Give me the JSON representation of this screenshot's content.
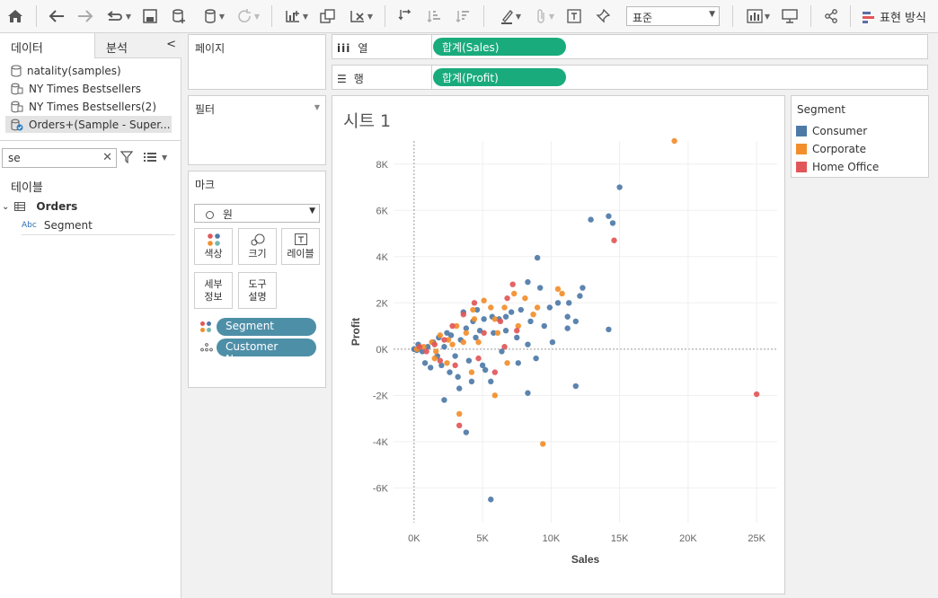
{
  "toolbar": {
    "icons": [
      "home-icon",
      "back-icon",
      "forward-icon",
      "redo-icon",
      "save-icon",
      "new-datasource-icon",
      "datasource-icon",
      "refresh-icon",
      "new-worksheet-icon",
      "duplicate-icon",
      "clear-icon",
      "swap-icon",
      "sort-asc-icon",
      "sort-desc-icon",
      "highlight-icon",
      "pin-icon",
      "label-icon",
      "fix-axes-icon",
      "show-cards-icon",
      "presentation-icon",
      "share-icon"
    ],
    "zoom_value": "표준",
    "showme_label": "표현 방식"
  },
  "data_pane": {
    "tab_data": "데이터",
    "tab_analysis": "분석",
    "collapse_glyph": "<",
    "datasources": [
      {
        "label": "natality(samples)",
        "icon": "database-icon",
        "selected": false
      },
      {
        "label": "NY Times Bestsellers",
        "icon": "multi-db-icon",
        "selected": false
      },
      {
        "label": "NY Times Bestsellers(2)",
        "icon": "multi-db-icon",
        "selected": false
      },
      {
        "label": "Orders+(Sample - Super...",
        "icon": "db-check-icon",
        "selected": true
      }
    ],
    "search_value": "se",
    "tables_label": "테이블",
    "table_name": "Orders",
    "field_type": "Abc",
    "field_name": "Segment"
  },
  "shelves": {
    "pages_label": "페이지",
    "filters_label": "필터",
    "columns_label": "열",
    "rows_label": "행",
    "columns_pill": "합계(Sales)",
    "rows_pill": "합계(Profit)"
  },
  "marks": {
    "title": "마크",
    "mark_type": "원",
    "buttons": [
      {
        "label": "색상",
        "icon": "color-icon"
      },
      {
        "label": "크기",
        "icon": "size-icon"
      },
      {
        "label": "레이블",
        "icon": "label-icon"
      },
      {
        "label": "세부\n정보",
        "icon": ""
      },
      {
        "label": "도구\n설명",
        "icon": ""
      }
    ],
    "pills": [
      "Segment",
      "Customer Name"
    ]
  },
  "sheet": {
    "title": "시트 1"
  },
  "legend": {
    "title": "Segment",
    "items": [
      {
        "label": "Consumer",
        "color": "#4e79a7"
      },
      {
        "label": "Corporate",
        "color": "#f28e2b"
      },
      {
        "label": "Home Office",
        "color": "#e15759"
      }
    ]
  },
  "chart_data": {
    "type": "scatter",
    "xlabel": "Sales",
    "ylabel": "Profit",
    "x_ticks": [
      "0K",
      "5K",
      "10K",
      "15K",
      "20K",
      "25K"
    ],
    "y_ticks": [
      "8K",
      "6K",
      "4K",
      "2K",
      "0K",
      "-2K",
      "-4K",
      "-6K"
    ],
    "xlim": [
      -1500,
      26500
    ],
    "ylim": [
      -7500,
      9000
    ],
    "series": [
      {
        "name": "Consumer",
        "color": "#4e79a7",
        "points": [
          [
            15000,
            7000
          ],
          [
            12900,
            5600
          ],
          [
            14200,
            5750
          ],
          [
            14500,
            5450
          ],
          [
            9000,
            3950
          ],
          [
            8300,
            2900
          ],
          [
            9200,
            2650
          ],
          [
            12300,
            2650
          ],
          [
            11300,
            2000
          ],
          [
            12100,
            2300
          ],
          [
            9900,
            1800
          ],
          [
            10500,
            2000
          ],
          [
            11200,
            1400
          ],
          [
            11800,
            1200
          ],
          [
            11200,
            900
          ],
          [
            14200,
            850
          ],
          [
            7100,
            1600
          ],
          [
            7800,
            1700
          ],
          [
            8500,
            1200
          ],
          [
            9500,
            1000
          ],
          [
            10100,
            300
          ],
          [
            6200,
            1300
          ],
          [
            5700,
            1400
          ],
          [
            6700,
            800
          ],
          [
            7500,
            500
          ],
          [
            8300,
            200
          ],
          [
            8900,
            -400
          ],
          [
            7600,
            -600
          ],
          [
            11800,
            -1600
          ],
          [
            8300,
            -1900
          ],
          [
            5600,
            -1400
          ],
          [
            5000,
            -700
          ],
          [
            4200,
            -1400
          ],
          [
            3300,
            -1700
          ],
          [
            3800,
            -3600
          ],
          [
            2200,
            -2200
          ],
          [
            3200,
            -1200
          ],
          [
            5600,
            -6500
          ],
          [
            5200,
            -900
          ],
          [
            6400,
            -100
          ],
          [
            4500,
            500
          ],
          [
            5100,
            1300
          ],
          [
            4300,
            1200
          ],
          [
            4800,
            800
          ],
          [
            3800,
            900
          ],
          [
            3400,
            400
          ],
          [
            3000,
            -300
          ],
          [
            2700,
            600
          ],
          [
            2200,
            100
          ],
          [
            1700,
            -300
          ],
          [
            1400,
            300
          ],
          [
            1000,
            100
          ],
          [
            600,
            -100
          ],
          [
            300,
            200
          ],
          [
            0,
            0
          ],
          [
            200,
            -50
          ],
          [
            800,
            -600
          ],
          [
            1200,
            -800
          ],
          [
            2000,
            -700
          ],
          [
            2600,
            -1000
          ],
          [
            4000,
            -500
          ],
          [
            4600,
            1700
          ],
          [
            5800,
            700
          ],
          [
            6700,
            1400
          ],
          [
            3600,
            1600
          ],
          [
            2400,
            700
          ],
          [
            1800,
            500
          ]
        ]
      },
      {
        "name": "Corporate",
        "color": "#f28e2b",
        "points": [
          [
            19000,
            9000
          ],
          [
            10500,
            2600
          ],
          [
            10800,
            2400
          ],
          [
            9000,
            1800
          ],
          [
            8100,
            2200
          ],
          [
            7300,
            2400
          ],
          [
            6600,
            1800
          ],
          [
            5900,
            1300
          ],
          [
            5100,
            2100
          ],
          [
            4400,
            1300
          ],
          [
            3800,
            700
          ],
          [
            3100,
            1000
          ],
          [
            2500,
            400
          ],
          [
            1900,
            600
          ],
          [
            1300,
            300
          ],
          [
            700,
            100
          ],
          [
            200,
            0
          ],
          [
            9400,
            -4100
          ],
          [
            5900,
            -2000
          ],
          [
            3300,
            -2800
          ],
          [
            4200,
            -1000
          ],
          [
            2400,
            -600
          ],
          [
            6800,
            -600
          ],
          [
            1500,
            -400
          ],
          [
            4700,
            300
          ],
          [
            3600,
            300
          ],
          [
            6100,
            700
          ],
          [
            7600,
            1000
          ],
          [
            8700,
            1500
          ],
          [
            5600,
            1800
          ],
          [
            4300,
            1700
          ],
          [
            2800,
            200
          ],
          [
            1600,
            -100
          ]
        ]
      },
      {
        "name": "Home Office",
        "color": "#e15759",
        "points": [
          [
            25000,
            -1950
          ],
          [
            14600,
            4700
          ],
          [
            7200,
            2800
          ],
          [
            6800,
            2200
          ],
          [
            4400,
            2000
          ],
          [
            3600,
            1500
          ],
          [
            2800,
            1000
          ],
          [
            5100,
            700
          ],
          [
            6300,
            1200
          ],
          [
            7500,
            800
          ],
          [
            2200,
            400
          ],
          [
            1500,
            200
          ],
          [
            900,
            -100
          ],
          [
            400,
            100
          ],
          [
            5900,
            -1000
          ],
          [
            3300,
            -3300
          ],
          [
            4700,
            -400
          ],
          [
            6600,
            100
          ],
          [
            3000,
            -700
          ],
          [
            1900,
            -500
          ]
        ]
      }
    ]
  }
}
